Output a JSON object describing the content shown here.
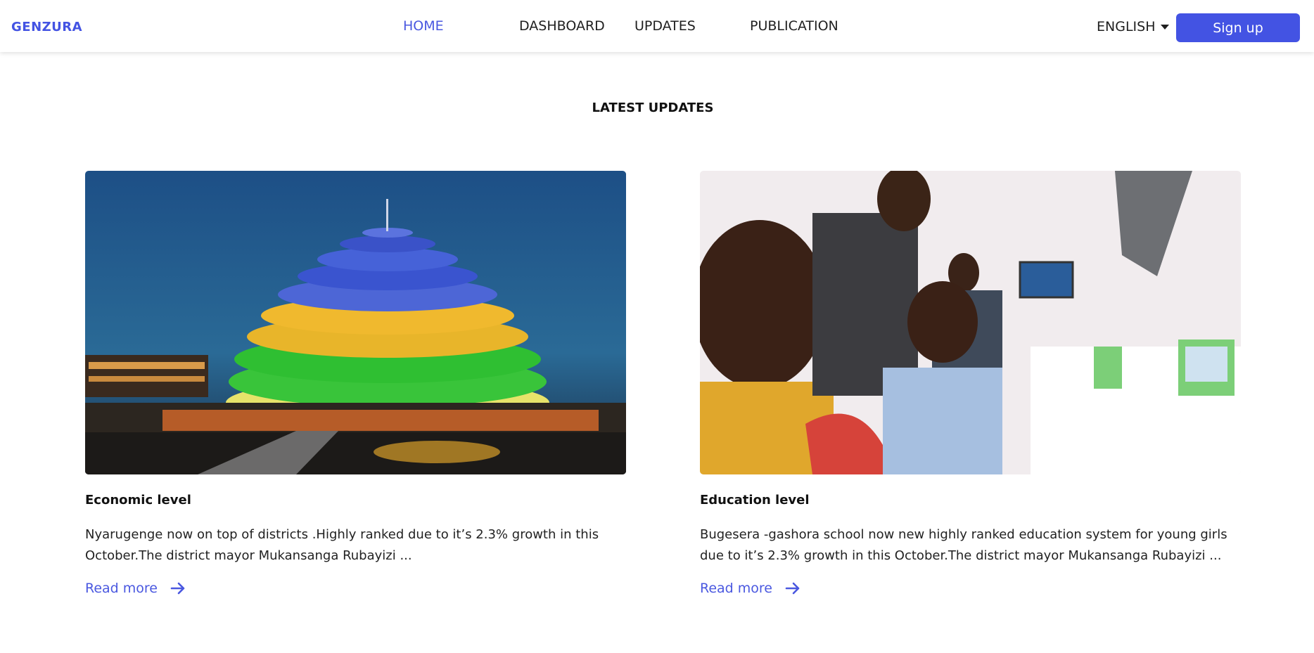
{
  "header": {
    "logo": "GENZURA",
    "nav": [
      {
        "label": "HOME",
        "active": true
      },
      {
        "label": "DASHBOARD",
        "active": false
      },
      {
        "label": "UPDATES",
        "active": false
      },
      {
        "label": "PUBLICATION",
        "active": false
      }
    ],
    "language": "ENGLISH",
    "signup_label": "Sign up"
  },
  "main": {
    "section_title": "LATEST UPDATES",
    "cards": [
      {
        "title": "Economic level",
        "text": "Nyarugenge now on top of districts .Highly ranked due to it’s 2.3% growth in this October.The district mayor Mukansanga Rubayizi ...",
        "link": "Read more"
      },
      {
        "title": "Education level",
        "text": "Bugesera -gashora school now new highly ranked education system for young girls due to it’s 2.3% growth in this October.The district mayor Mukansanga Rubayizi ...",
        "link": "Read more"
      }
    ]
  },
  "colors": {
    "accent": "#4353e3",
    "link": "#4a58e0"
  }
}
